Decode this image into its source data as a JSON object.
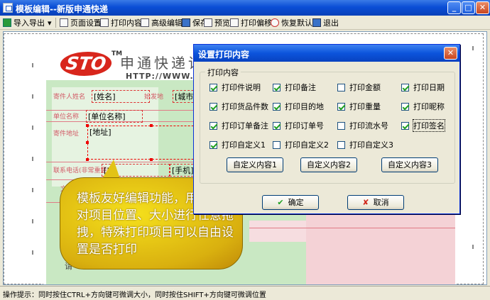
{
  "window": {
    "title": "模板编辑--新版申通快递"
  },
  "toolbar": {
    "items": [
      {
        "label": "导入导出",
        "icon": "import-export-icon"
      },
      {
        "label": "页面设置",
        "icon": "page-setup-icon"
      },
      {
        "label": "打印内容",
        "icon": "print-content-icon"
      },
      {
        "label": "高级编辑",
        "icon": "advanced-edit-icon"
      },
      {
        "label": "保存",
        "icon": "save-icon"
      },
      {
        "label": "预览",
        "icon": "preview-icon"
      },
      {
        "label": "打印偏移",
        "icon": "print-offset-icon"
      },
      {
        "label": "恢复默认",
        "icon": "restore-default-icon"
      },
      {
        "label": "退出",
        "icon": "exit-icon"
      }
    ],
    "dropdown_arrow": "▾"
  },
  "template": {
    "brand": "STO",
    "tm": "TM",
    "company_name": "申通快递详情",
    "url": "HTTP://WWW.STO.CN",
    "labels": {
      "sender_name": "寄件人姓名",
      "origin": "始发地",
      "unit_name": "单位名称",
      "sender_address": "寄件地址",
      "phone": "联系电话(非常重要)"
    },
    "fields": {
      "name": "[姓名]",
      "city": "[城市]",
      "unit": "[单位名称]",
      "address": "[地址]",
      "tel": "[电",
      "mobile": "[手机]"
    },
    "tail_text": "请",
    "marker_text": "文"
  },
  "callout": {
    "text": "模板友好编辑功能，用户只可对项目位置、大小进行任意拖拽，特殊打印项目可以自由设置是否打印"
  },
  "dialog": {
    "title": "设置打印内容",
    "close": "✕",
    "group_label": "打印内容",
    "checkboxes": [
      {
        "label": "打印件说明",
        "checked": true
      },
      {
        "label": "打印备注",
        "checked": true
      },
      {
        "label": "打印金额",
        "checked": false
      },
      {
        "label": "打印日期",
        "checked": true
      },
      {
        "label": "打印货品件数",
        "checked": true
      },
      {
        "label": "打印目的地",
        "checked": true
      },
      {
        "label": "打印重量",
        "checked": true
      },
      {
        "label": "打印昵称",
        "checked": true
      },
      {
        "label": "打印订单备注",
        "checked": true
      },
      {
        "label": "打印订单号",
        "checked": true
      },
      {
        "label": "打印流水号",
        "checked": false
      },
      {
        "label": "打印签名",
        "checked": true
      },
      {
        "label": "打印自定义1",
        "checked": true
      },
      {
        "label": "打印自定义2",
        "checked": false
      },
      {
        "label": "打印自定义3",
        "checked": false
      }
    ],
    "custom_buttons": [
      "自定义内容1",
      "自定义内容2",
      "自定义内容3"
    ],
    "ok_label": "确定",
    "cancel_label": "取消",
    "ok_icon": "✔",
    "cancel_icon": "✘"
  },
  "status": {
    "text": "操作提示：同时按住CTRL+方向键可微调大小，同时按住SHIFT+方向键可微调位置"
  }
}
